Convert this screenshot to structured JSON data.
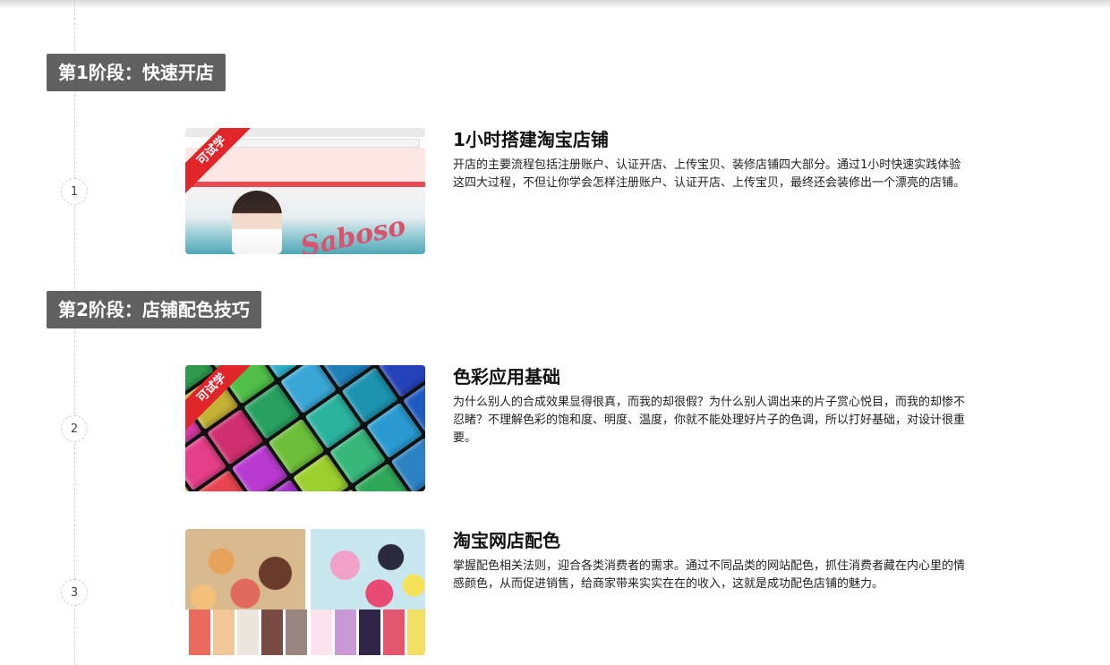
{
  "stages": [
    {
      "label": "第1阶段：快速开店"
    },
    {
      "label": "第2阶段：店铺配色技巧"
    }
  ],
  "lessons": [
    {
      "number": "1",
      "badge": "可试学",
      "title": "1小时搭建淘宝店铺",
      "description": "开店的主要流程包括注册账户、认证开店、上传宝贝、装修店铺四大部分。通过1小时快速实践体验这四大过程，不但让你学会怎样注册账户、认证开店、上传宝贝，最终还会装修出一个漂亮的店铺。",
      "thumbnail_text": "Saboso"
    },
    {
      "number": "2",
      "badge": "可试学",
      "title": "色彩应用基础",
      "description": "为什么别人的合成效果显得很真，而我的却很假？为什么别人调出来的片子赏心悦目，而我的却惨不忍睹？不理解色彩的饱和度、明度、温度，你就不能处理好片子的色调，所以打好基础，对设计很重要。"
    },
    {
      "number": "3",
      "badge": "",
      "title": "淘宝网店配色",
      "description": "掌握配色相关法则，迎合各类消费者的需求。通过不同品类的网站配色，抓住消费者藏在内心里的情感颜色，从而促进销售，给商家带来实实在在的收入，这就是成功配色店铺的魅力。",
      "swatches": [
        "#ea6b5e",
        "#f1c79a",
        "#ede6df",
        "#7a4a45",
        "#9a8681",
        "#fde3ee",
        "#c79ad3",
        "#2f2546",
        "#e4566e",
        "#f3df62"
      ]
    }
  ],
  "cube_colors": [
    "#e83f8c",
    "#f16eb0",
    "#2e9b4f",
    "#39b25a",
    "#1e4fd1",
    "#2a6ae0",
    "#2a88e8",
    "#15339c",
    "#f0a21e",
    "#d93aa4",
    "#c4b236",
    "#4fbf48",
    "#2fb0c8",
    "#168c7e",
    "#1c3fbf",
    "#0f2a80",
    "#f5c02b",
    "#e63f8a",
    "#cf2f6f",
    "#28a160",
    "#3aa7d7",
    "#1e7fb8",
    "#3d52d3",
    "#231f7a",
    "#f08a20",
    "#e8434f",
    "#b93ad0",
    "#6dbf3a",
    "#2bb3a0",
    "#1c94b0",
    "#2443b8",
    "#3b1f8e",
    "#f7b92b",
    "#e94c7a",
    "#a631c9",
    "#9bcf2e",
    "#37b77a",
    "#2a9ad0",
    "#1f5ac0",
    "#4a1c8c",
    "#f2962e",
    "#ec5a6a",
    "#8e39c7",
    "#c1d63a",
    "#2fa85a",
    "#2b82c4",
    "#2c3fa8",
    "#5a1f86"
  ]
}
